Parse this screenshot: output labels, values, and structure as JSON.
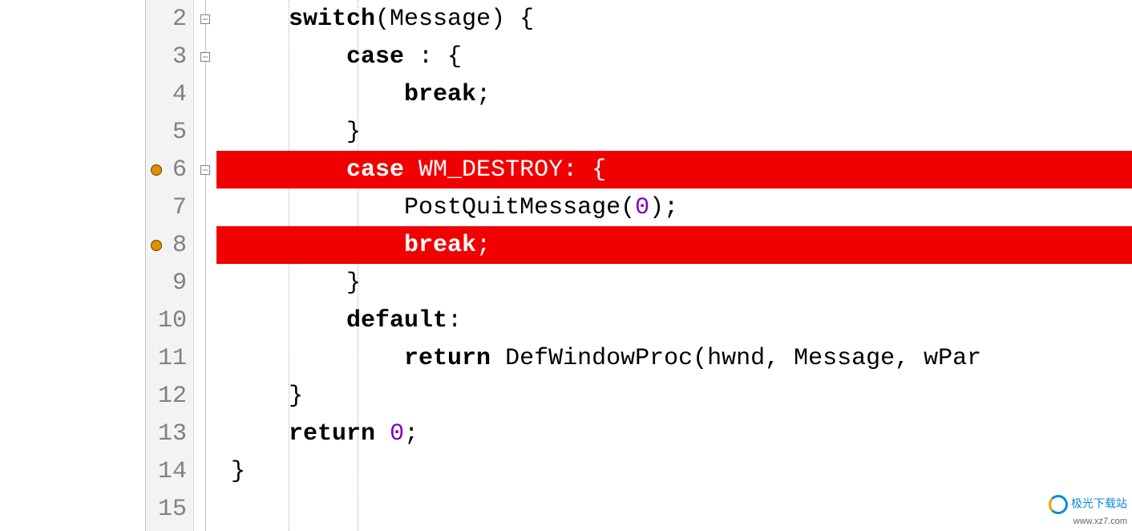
{
  "lines": [
    {
      "num": "2",
      "fold": true,
      "bp": false,
      "hl": false,
      "indent": 1,
      "tokens": [
        {
          "c": "kw",
          "t": "switch"
        },
        {
          "c": "txt",
          "t": "(Message) {"
        }
      ]
    },
    {
      "num": "3",
      "fold": true,
      "bp": false,
      "hl": false,
      "indent": 2,
      "tokens": [
        {
          "c": "kw",
          "t": "case"
        },
        {
          "c": "txt",
          "t": " : {"
        }
      ]
    },
    {
      "num": "4",
      "fold": false,
      "bp": false,
      "hl": false,
      "indent": 3,
      "tokens": [
        {
          "c": "kw",
          "t": "break"
        },
        {
          "c": "txt",
          "t": ";"
        }
      ]
    },
    {
      "num": "5",
      "fold": false,
      "bp": false,
      "hl": false,
      "indent": 2,
      "tokens": [
        {
          "c": "txt",
          "t": "}"
        }
      ]
    },
    {
      "num": "6",
      "fold": true,
      "bp": true,
      "hl": true,
      "indent": 2,
      "tokens": [
        {
          "c": "kw",
          "t": "case"
        },
        {
          "c": "txt",
          "t": " WM_DESTROY: {"
        }
      ]
    },
    {
      "num": "7",
      "fold": false,
      "bp": false,
      "hl": false,
      "indent": 3,
      "tokens": [
        {
          "c": "txt",
          "t": "PostQuitMessage("
        },
        {
          "c": "num",
          "t": "0"
        },
        {
          "c": "txt",
          "t": ");"
        }
      ]
    },
    {
      "num": "8",
      "fold": false,
      "bp": true,
      "hl": true,
      "indent": 3,
      "tokens": [
        {
          "c": "kw",
          "t": "break"
        },
        {
          "c": "txt",
          "t": ";"
        }
      ]
    },
    {
      "num": "9",
      "fold": false,
      "bp": false,
      "hl": false,
      "indent": 2,
      "tokens": [
        {
          "c": "txt",
          "t": "}"
        }
      ]
    },
    {
      "num": "10",
      "fold": false,
      "bp": false,
      "hl": false,
      "indent": 2,
      "tokens": [
        {
          "c": "kw",
          "t": "default"
        },
        {
          "c": "txt",
          "t": ":"
        }
      ]
    },
    {
      "num": "11",
      "fold": false,
      "bp": false,
      "hl": false,
      "indent": 3,
      "tokens": [
        {
          "c": "kw",
          "t": "return"
        },
        {
          "c": "txt",
          "t": " DefWindowProc(hwnd, Message, wPar"
        }
      ]
    },
    {
      "num": "12",
      "fold": false,
      "bp": false,
      "hl": false,
      "indent": 1,
      "tokens": [
        {
          "c": "txt",
          "t": "}"
        }
      ]
    },
    {
      "num": "13",
      "fold": false,
      "bp": false,
      "hl": false,
      "indent": 1,
      "tokens": [
        {
          "c": "kw",
          "t": "return"
        },
        {
          "c": "txt",
          "t": " "
        },
        {
          "c": "num",
          "t": "0"
        },
        {
          "c": "txt",
          "t": ";"
        }
      ]
    },
    {
      "num": "14",
      "fold": false,
      "bp": false,
      "hl": false,
      "indent": 0,
      "tokens": [
        {
          "c": "txt",
          "t": "}"
        }
      ]
    },
    {
      "num": "15",
      "fold": false,
      "bp": false,
      "hl": false,
      "indent": 0,
      "tokens": []
    }
  ],
  "watermark": {
    "brand": "极光下载站",
    "site": "www.xz7.com"
  },
  "indentUnit": "    "
}
